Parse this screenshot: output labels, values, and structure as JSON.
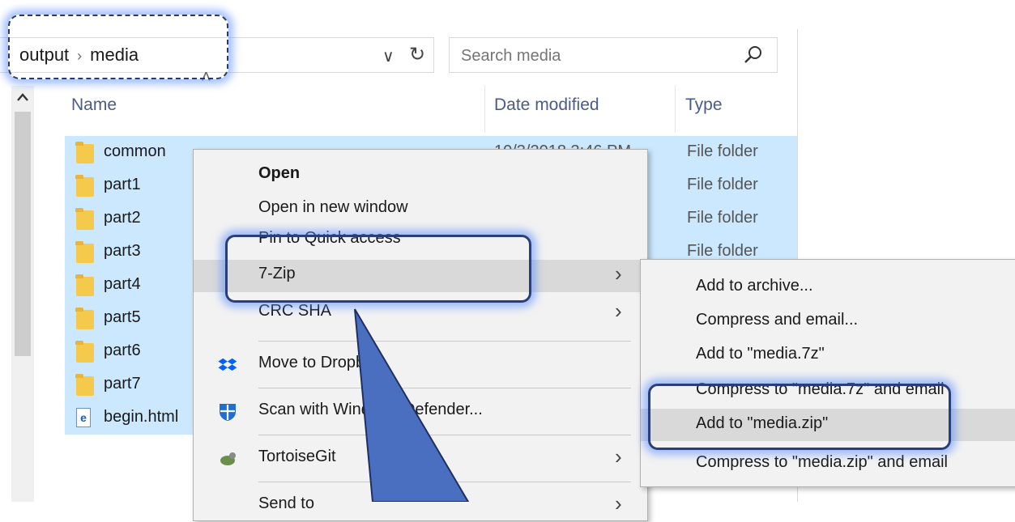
{
  "address_bar": {
    "crumbs": [
      "output",
      "media"
    ],
    "separator": "›"
  },
  "search": {
    "placeholder": "Search media"
  },
  "columns": {
    "name": "Name",
    "date_modified": "Date modified",
    "type": "Type"
  },
  "files": [
    {
      "name": "common",
      "type": "File folder",
      "date": "10/3/2018 3:46 PM",
      "icon": "folder-icon"
    },
    {
      "name": "part1",
      "type": "File folder",
      "date": "",
      "icon": "folder-icon"
    },
    {
      "name": "part2",
      "type": "File folder",
      "date": "",
      "icon": "folder-icon"
    },
    {
      "name": "part3",
      "type": "File folder",
      "date": "",
      "icon": "folder-icon"
    },
    {
      "name": "part4",
      "type": "",
      "date": "",
      "icon": "folder-icon"
    },
    {
      "name": "part5",
      "type": "",
      "date": "",
      "icon": "folder-icon"
    },
    {
      "name": "part6",
      "type": "",
      "date": "",
      "icon": "folder-icon"
    },
    {
      "name": "part7",
      "type": "",
      "date": "",
      "icon": "folder-icon"
    },
    {
      "name": "begin.html",
      "type": "",
      "date": "",
      "icon": "html-file-icon"
    }
  ],
  "context_menu": {
    "items": [
      {
        "label": "Open"
      },
      {
        "label": "Open in new window"
      },
      {
        "label": "Pin to Quick access"
      },
      {
        "label": "7-Zip"
      },
      {
        "label": "CRC SHA"
      },
      {
        "label": "Move to Dropbox"
      },
      {
        "label": "Scan with Windows Defender..."
      },
      {
        "label": "TortoiseGit"
      },
      {
        "label": "Send to"
      }
    ]
  },
  "submenu_7zip": {
    "items": [
      {
        "label": "Add to archive..."
      },
      {
        "label": "Compress and email..."
      },
      {
        "label": "Add to \"media.7z\""
      },
      {
        "label": "Compress to \"media.7z\" and email"
      },
      {
        "label": "Add to \"media.zip\""
      },
      {
        "label": "Compress to \"media.zip\" and email"
      }
    ]
  },
  "colors": {
    "selection": "#cce8ff",
    "menu_bg": "#f2f2f2",
    "menu_hot": "#d9d9d9",
    "callout_fill": "#4a6fc1",
    "glow": "#5a8cff"
  }
}
